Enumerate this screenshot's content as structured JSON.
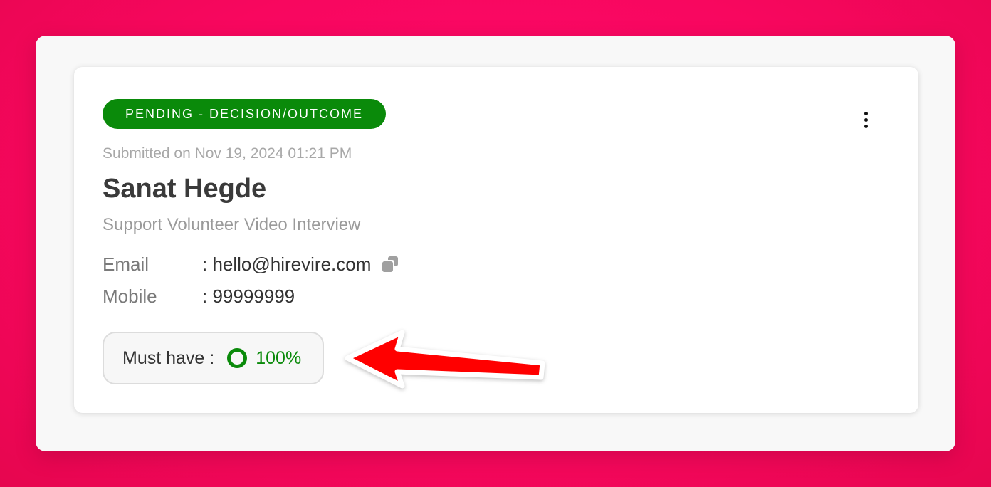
{
  "card": {
    "status_badge": "PENDING - DECISION/OUTCOME",
    "submitted": "Submitted on Nov 19, 2024 01:21 PM",
    "name": "Sanat Hegde",
    "subtitle": "Support Volunteer Video Interview",
    "email": {
      "label": "Email",
      "value": ": hello@hirevire.com"
    },
    "mobile": {
      "label": "Mobile",
      "value": ": 99999999"
    },
    "must_have": {
      "label": "Must have :",
      "value": "100%",
      "fraction": 1.0
    }
  },
  "icons": {
    "menu": "more-vertical-icon",
    "copy": "copy-icon",
    "ring": "ring-icon",
    "annotation": "red-arrow-annotation"
  },
  "colors": {
    "background": "#ff0a6e",
    "badge": "#0a8a0a",
    "success_text": "#0a8a0a",
    "annotation_arrow": "#ff0000"
  }
}
